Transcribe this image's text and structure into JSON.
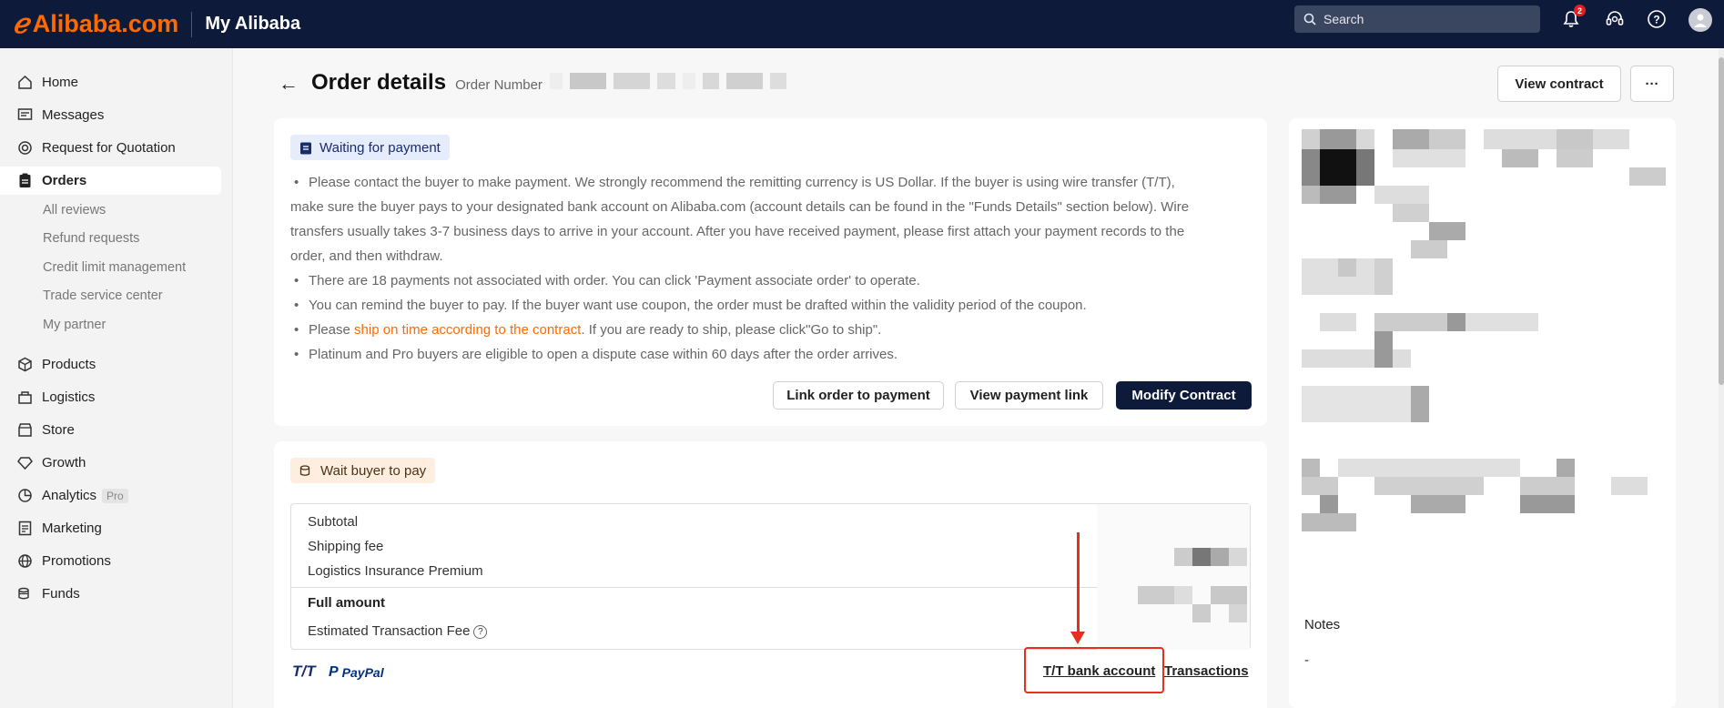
{
  "topbar": {
    "logo": "Alibaba.com",
    "app_title": "My Alibaba",
    "search_placeholder": "Search",
    "notification_count": "2"
  },
  "sidebar": {
    "items": [
      {
        "label": "Home",
        "icon": "home-icon"
      },
      {
        "label": "Messages",
        "icon": "message-icon"
      },
      {
        "label": "Request for Quotation",
        "icon": "target-icon"
      },
      {
        "label": "Orders",
        "icon": "clipboard-icon"
      },
      {
        "label": "Products",
        "icon": "cube-icon"
      },
      {
        "label": "Logistics",
        "icon": "box-icon"
      },
      {
        "label": "Store",
        "icon": "store-icon"
      },
      {
        "label": "Growth",
        "icon": "diamond-icon"
      },
      {
        "label": "Analytics",
        "icon": "chart-icon"
      },
      {
        "label": "Marketing",
        "icon": "document-icon"
      },
      {
        "label": "Promotions",
        "icon": "globe-icon"
      },
      {
        "label": "Funds",
        "icon": "coins-icon"
      }
    ],
    "sub_items": [
      "All reviews",
      "Refund requests",
      "Credit limit management",
      "Trade service center",
      "My partner"
    ],
    "pro_tag": "Pro"
  },
  "page": {
    "title": "Order details",
    "order_label": "Order Number",
    "view_contract": "View contract",
    "more": "···"
  },
  "waiting_card": {
    "status": "Waiting for payment",
    "bullet1_line1": "Please contact the buyer to make payment. We strongly recommend the remitting currency is US Dollar. If the buyer is using wire transfer (T/T),",
    "bullet1_line2": "make sure the buyer pays to your designated bank account on Alibaba.com (account details can be found in the \"Funds Details\" section below). Wire",
    "bullet1_line3": "transfers usually takes 3-7 business days to arrive in your account. After you have received payment, please first attach your payment records to the",
    "bullet1_line4": "order, and then withdraw.",
    "bullet2": "There are 18 payments not associated with order. You can click 'Payment associate order' to operate.",
    "bullet3": "You can remind the buyer to pay. If the buyer want use coupon, the order must be drafted within the validity period of the coupon.",
    "bullet4_pre": "Please ",
    "bullet4_link": "ship on time according to the contract",
    "bullet4_post": ". If you are ready to ship, please click\"Go to ship\".",
    "bullet5": "Platinum and Pro buyers are eligible to open a dispute case within 60 days after the order arrives.",
    "btn_link_order": "Link order to payment",
    "btn_view_link": "View payment link",
    "btn_modify": "Modify Contract"
  },
  "pay_card": {
    "status": "Wait buyer to pay",
    "rows": [
      "Subtotal",
      "Shipping fee",
      "Logistics Insurance Premium"
    ],
    "full_amount": "Full amount",
    "fee_label": "Estimated Transaction Fee",
    "tt_logo": "T/T",
    "paypal_logo": "PayPal",
    "tt_bank_link": "T/T bank account",
    "transactions_link": "Transactions"
  },
  "notes": {
    "title": "Notes",
    "value": "-"
  },
  "colors": {
    "brand_orange": "#ff6a00",
    "topbar_navy": "#0d1a3a",
    "annotation_red": "#e53020"
  }
}
